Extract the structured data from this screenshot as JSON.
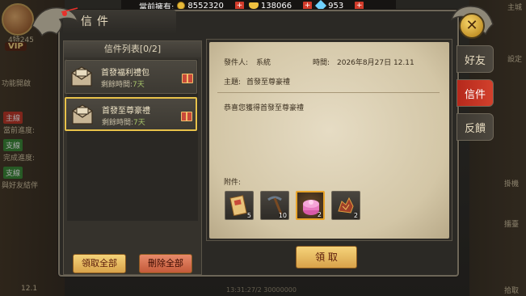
{
  "top_bar": {
    "label": "當前擁有:",
    "gold": "8552320",
    "ingot": "138066",
    "diamond": "953"
  },
  "window": {
    "title": "信件"
  },
  "list": {
    "header": "信件列表[0/2]",
    "items": [
      {
        "title": "首發福利禮包",
        "time_label": "剩餘時間:",
        "time_value": "7天",
        "selected": false
      },
      {
        "title": "首發至尊豪禮",
        "time_label": "剩餘時間:",
        "time_value": "7天",
        "selected": true
      }
    ],
    "claim_all_label": "領取全部",
    "delete_all_label": "刪除全部"
  },
  "detail": {
    "sender_label": "發件人:",
    "sender_value": "系統",
    "time_label": "時間:",
    "time_value": "2026年8月27日 12.11",
    "subject_label": "主題:",
    "subject_value": "首發至尊豪禮",
    "body": "恭喜您獲得首發至尊豪禮",
    "attachments_label": "附件:",
    "attachments": [
      {
        "name": "scroll-card",
        "count": "5",
        "highlighted": false
      },
      {
        "name": "pickaxe",
        "count": "10",
        "highlighted": false
      },
      {
        "name": "pink-gift-box",
        "count": "2",
        "highlighted": true
      },
      {
        "name": "red-ore",
        "count": "2",
        "highlighted": false
      }
    ],
    "claim_label": "領 取"
  },
  "tabs": [
    {
      "label": "好友",
      "active": false
    },
    {
      "label": "信件",
      "active": true
    },
    {
      "label": "反饋",
      "active": false
    }
  ],
  "background": {
    "vip": "VIP",
    "player_level": "4特245",
    "left_texts": [
      "功能開啟",
      "主線",
      "當前進度:",
      "支線",
      "完成進度:",
      "支線",
      "與好友結伴"
    ],
    "right_texts": [
      "主城",
      "設定",
      "掛機",
      "擂臺",
      "拾取"
    ],
    "bottom_left": "12.1",
    "bottom_mid": "13:31:27/2 30000000"
  },
  "colors": {
    "accent_gold": "#e8c24a",
    "active_tab": "#c9331f",
    "time_green": "#a8c56a"
  }
}
